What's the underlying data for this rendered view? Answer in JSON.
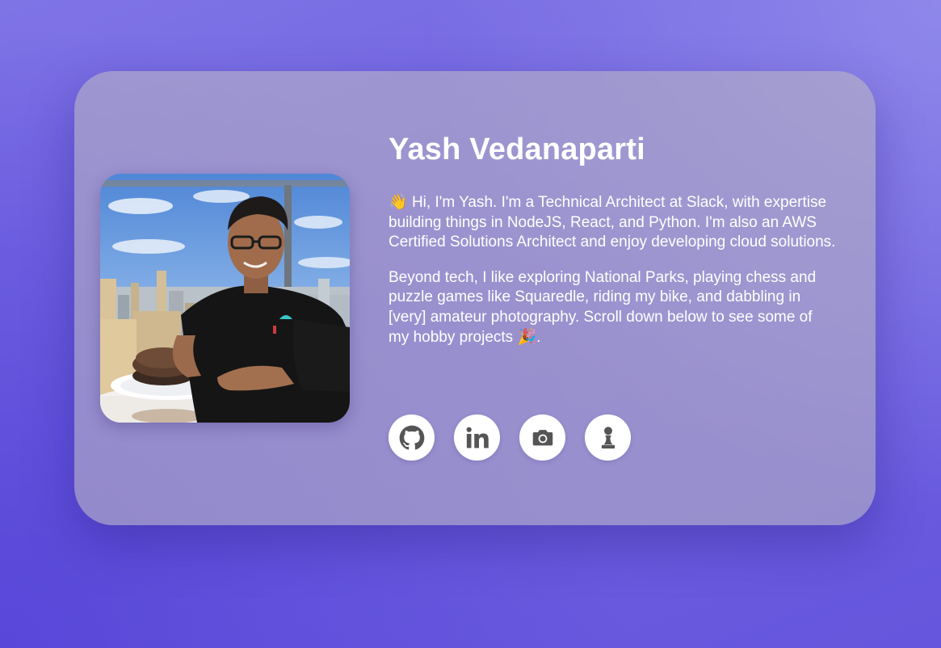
{
  "profile": {
    "name": "Yash Vedanaparti",
    "photo_alt": "Yash Vedanaparti"
  },
  "bio": {
    "paragraph1_emoji": "👋",
    "paragraph1_text": "Hi, I'm Yash. I'm a Technical Architect at Slack, with expertise building things in NodeJS, React, and Python. I'm also an AWS Certified Solutions Architect and enjoy developing cloud solutions.",
    "paragraph2_text": "Beyond tech, I like exploring National Parks, playing chess and puzzle games like Squaredle, riding my bike, and dabbling in [very] amateur photography. Scroll down below to see some of my hobby projects ",
    "paragraph2_emoji": "🎉",
    "paragraph2_end": "."
  },
  "socials": [
    {
      "icon": "github-icon"
    },
    {
      "icon": "linkedin-icon"
    },
    {
      "icon": "camera-icon"
    },
    {
      "icon": "chess-pawn-icon"
    }
  ],
  "colors": {
    "background": "#6e60e0",
    "card": "#a9a3c6",
    "text": "#ffffff",
    "icon": "#555555"
  }
}
